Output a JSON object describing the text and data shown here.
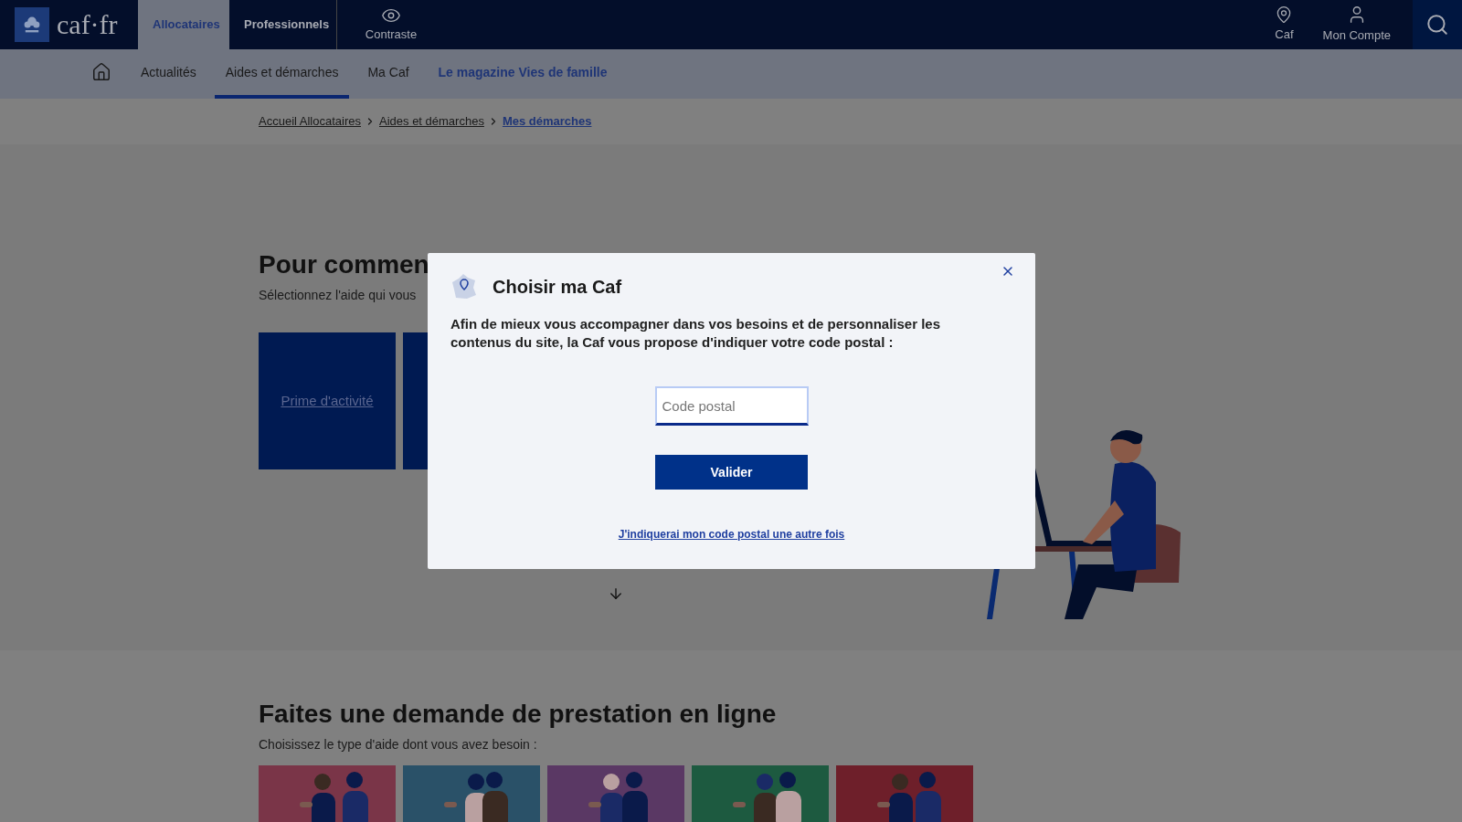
{
  "header": {
    "logo": "caf·fr",
    "tabs": [
      {
        "label": "Allocataires",
        "selected": true
      },
      {
        "label": "Professionnels",
        "selected": false
      }
    ],
    "contrast": {
      "label": "Contraste"
    },
    "right_items": [
      {
        "kind": "pin",
        "label": "Caf"
      },
      {
        "kind": "user",
        "label": "Mon Compte"
      }
    ]
  },
  "nav": {
    "items": [
      {
        "kind": "home",
        "selected": false
      },
      {
        "kind": "section",
        "label": "Actualités",
        "selected": false
      },
      {
        "kind": "section",
        "label": "Aides et démarches",
        "selected": true
      },
      {
        "kind": "section",
        "label": "Ma Caf",
        "selected": false
      },
      {
        "kind": "featured",
        "label": "Le magazine Vies de famille",
        "selected": false
      }
    ]
  },
  "breadcrumb": [
    {
      "label": "Accueil Allocataires",
      "current": false
    },
    {
      "label": "Aides et démarches",
      "current": false
    },
    {
      "label": "Mes démarches",
      "current": true
    }
  ],
  "hero": {
    "title": "Pour commen",
    "subtitle": "Sélectionnez l'aide qui vous",
    "cards": [
      {
        "kind": "card",
        "label": "Prime d'activité"
      },
      {
        "kind": "card"
      }
    ]
  },
  "modal": {
    "title": "Choisir ma Caf",
    "text": "Afin de mieux vous accompagner dans vos besoins et de personnaliser les contenus du site, la Caf vous propose d'indiquer votre code postal :",
    "input": {
      "placeholder": "Code postal"
    },
    "button": "Valider",
    "link": "J'indiquerai mon code postal une autre fois"
  },
  "section": {
    "title": "Faites une demande de prestation en ligne",
    "subtitle": "Choisissez le type d'aide dont vous avez besoin :"
  }
}
